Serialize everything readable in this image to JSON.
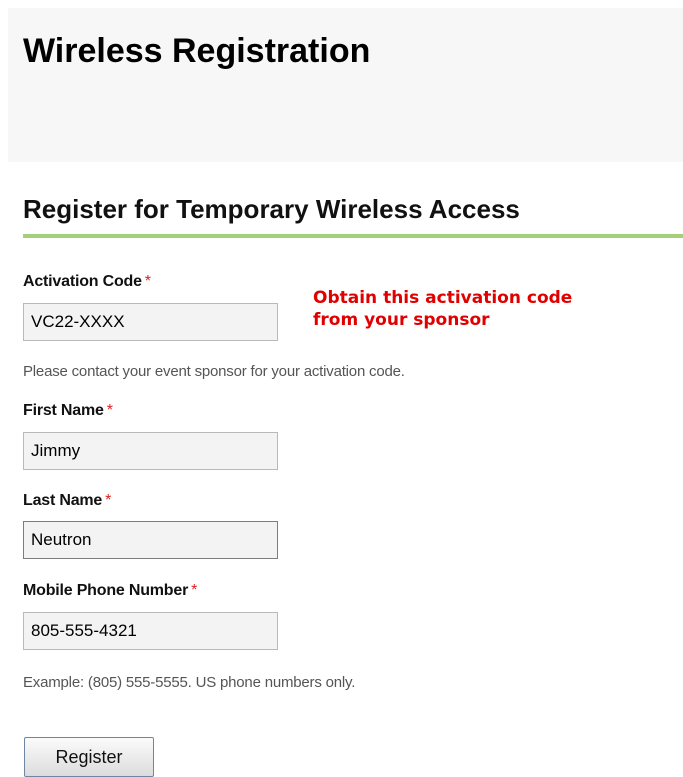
{
  "header": {
    "title": "Wireless Registration"
  },
  "section": {
    "title": "Register for Temporary Wireless Access"
  },
  "form": {
    "required_marker": "*",
    "activation_code": {
      "label": "Activation Code",
      "value": "VC22-XXXX",
      "help": "Please contact your event sponsor for your activation code."
    },
    "first_name": {
      "label": "First Name",
      "value": "Jimmy"
    },
    "last_name": {
      "label": "Last Name",
      "value": "Neutron"
    },
    "mobile_phone": {
      "label": "Mobile Phone Number",
      "value": "805-555-4321",
      "help": "Example: (805) 555-5555. US phone numbers only."
    },
    "submit_label": "Register"
  },
  "annotation": {
    "line1": "Obtain this activation code",
    "line2": "from your sponsor",
    "color": "#e00000"
  },
  "colors": {
    "accent_rule": "#a6cf7a",
    "required": "#e02020",
    "header_band": "#f7f7f7"
  }
}
